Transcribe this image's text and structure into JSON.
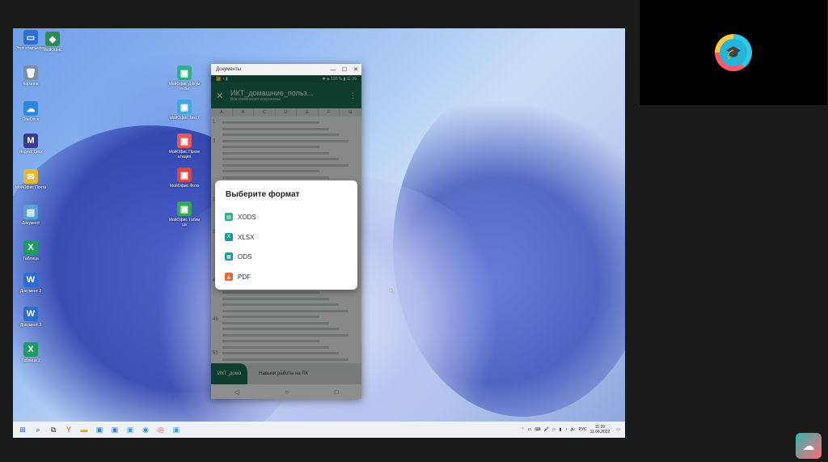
{
  "desktop": {
    "left_icons": [
      {
        "label": "Этот компьютер",
        "glyph": "▭",
        "color": "#2d6fd1"
      },
      {
        "label": "Корзина",
        "glyph": "🗑",
        "color": "#7a8ca8"
      },
      {
        "label": "OneDrive",
        "glyph": "☁",
        "color": "#2b88d8"
      },
      {
        "label": "Яндекс Диск",
        "glyph": "M",
        "color": "#3a3a8c"
      },
      {
        "label": "МойОфис Почта",
        "glyph": "✉",
        "color": "#e2b83a"
      },
      {
        "label": "Документ",
        "glyph": "▤",
        "color": "#5aa0d8"
      },
      {
        "label": "Таблица",
        "glyph": "X",
        "color": "#1f9a63"
      },
      {
        "label": "Документ 2",
        "glyph": "W",
        "color": "#2b6cd0"
      },
      {
        "label": "Документ 3",
        "glyph": "W",
        "color": "#2b6cd0"
      },
      {
        "label": "Таблица 2",
        "glyph": "X",
        "color": "#1f9a63"
      }
    ],
    "mid_icons": [
      {
        "label": "МойОфис Документы",
        "glyph": "▣",
        "color": "#2fae8c"
      },
      {
        "label": "МойОфис Текст",
        "glyph": "▣",
        "color": "#45a5df"
      },
      {
        "label": "МойОфис Презентация",
        "glyph": "▣",
        "color": "#e25a5a"
      },
      {
        "label": "МойОфис Фото",
        "glyph": "▣",
        "color": "#d64848"
      },
      {
        "label": "МойОфис Таблица",
        "glyph": "▣",
        "color": "#39a55a"
      }
    ],
    "top_icon": {
      "label": "МойОфис",
      "glyph": "◆",
      "color": "#2a8c5a"
    }
  },
  "window": {
    "title": "Документы",
    "min": "—",
    "max": "☐",
    "close": "✕"
  },
  "phone": {
    "status_left": "📶 ◔ ▮",
    "status_right": "✱ ◈ 100 % ▮ 11:39",
    "doc_title": "ИКТ_домашние_польз...",
    "doc_subtitle": "Все изменения сохранены",
    "close_icon": "✕",
    "more_icon": "⋮",
    "columns": [
      "A",
      "B",
      "C",
      "D",
      "E",
      "F",
      "G"
    ],
    "row_numbers": [
      "1",
      "3",
      "11",
      "17",
      "40",
      "45",
      "53"
    ],
    "tab_active": "ИКТ_домо",
    "tab_other": "Навыки работы на ПК",
    "nav_back": "◁",
    "nav_home": "○",
    "nav_recent": "□"
  },
  "dialog": {
    "title": "Выберите формат",
    "options": [
      {
        "label": "XODS",
        "icon": "▤",
        "color": "#2fae8c"
      },
      {
        "label": "XLSX",
        "icon": "X",
        "color": "#1f9a93"
      },
      {
        "label": "ODS",
        "icon": "▦",
        "color": "#1f9a93"
      },
      {
        "label": "PDF",
        "icon": "◭",
        "color": "#e8663a"
      }
    ]
  },
  "taskbar": {
    "icons": [
      "⊞",
      "⌕",
      "⧉",
      "Y",
      "▬",
      "▣",
      "▣",
      "▣",
      "◉",
      "◎",
      "▣"
    ],
    "tray_icons": [
      "⌃",
      "▭",
      "⌨",
      "🎤",
      "▭",
      "▮",
      "◔",
      "🔊"
    ],
    "lang": "РУС",
    "time": "11:39",
    "date": "11.06.2022",
    "notif": "▭"
  },
  "cam": {
    "logo_icon": "🎓"
  },
  "corner_logo_icon": "☁"
}
